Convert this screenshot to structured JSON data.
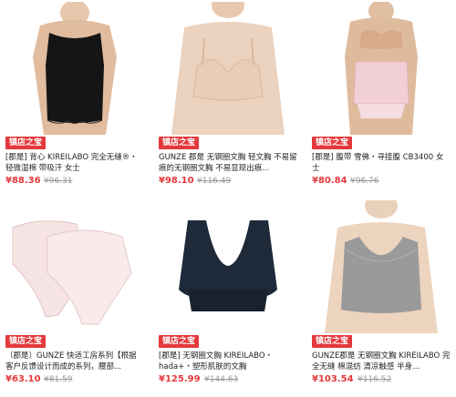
{
  "products": [
    {
      "badge": "镇店之宝",
      "title": "[郡是] 背心 KIREILABO 完全无缝®・轻微湿棉 带吸汗 女士",
      "price": "¥88.36",
      "orig": "¥96.31",
      "image": "black-camisole"
    },
    {
      "badge": "镇店之宝",
      "title": "GUNZE 郡是 无钢圈文胸 轻文胸 不易留痕的无钢圈文胸 不易显现出痕...",
      "price": "¥98.10",
      "orig": "¥116.49",
      "image": "nude-bra"
    },
    {
      "badge": "镇店之宝",
      "title": "[郡是] 腹带 雪佛・寻接腹 CB3400 女士",
      "price": "¥80.84",
      "orig": "¥96.76",
      "image": "waist-shaper"
    },
    {
      "badge": "镇店之宝",
      "title": "（郡是）GUNZE 快适工房系列【根据客户反馈设计而成的系列，腰部...",
      "price": "¥63.10",
      "orig": "¥81.59",
      "image": "pink-briefs"
    },
    {
      "badge": "镇店之宝",
      "title": "[郡是] 无钢圈文胸 KIREILABO・hada+・塑形肌肤的文胸",
      "price": "¥125.99",
      "orig": "¥144.63",
      "image": "black-bralette"
    },
    {
      "badge": "镇店之宝",
      "title": "GUNZE郡是 无钢圈文胸 KIREILABO 完全无缝 棉混纺 清凉触感 半身...",
      "price": "¥103.54",
      "orig": "¥116.52",
      "image": "grey-bra-top"
    }
  ]
}
